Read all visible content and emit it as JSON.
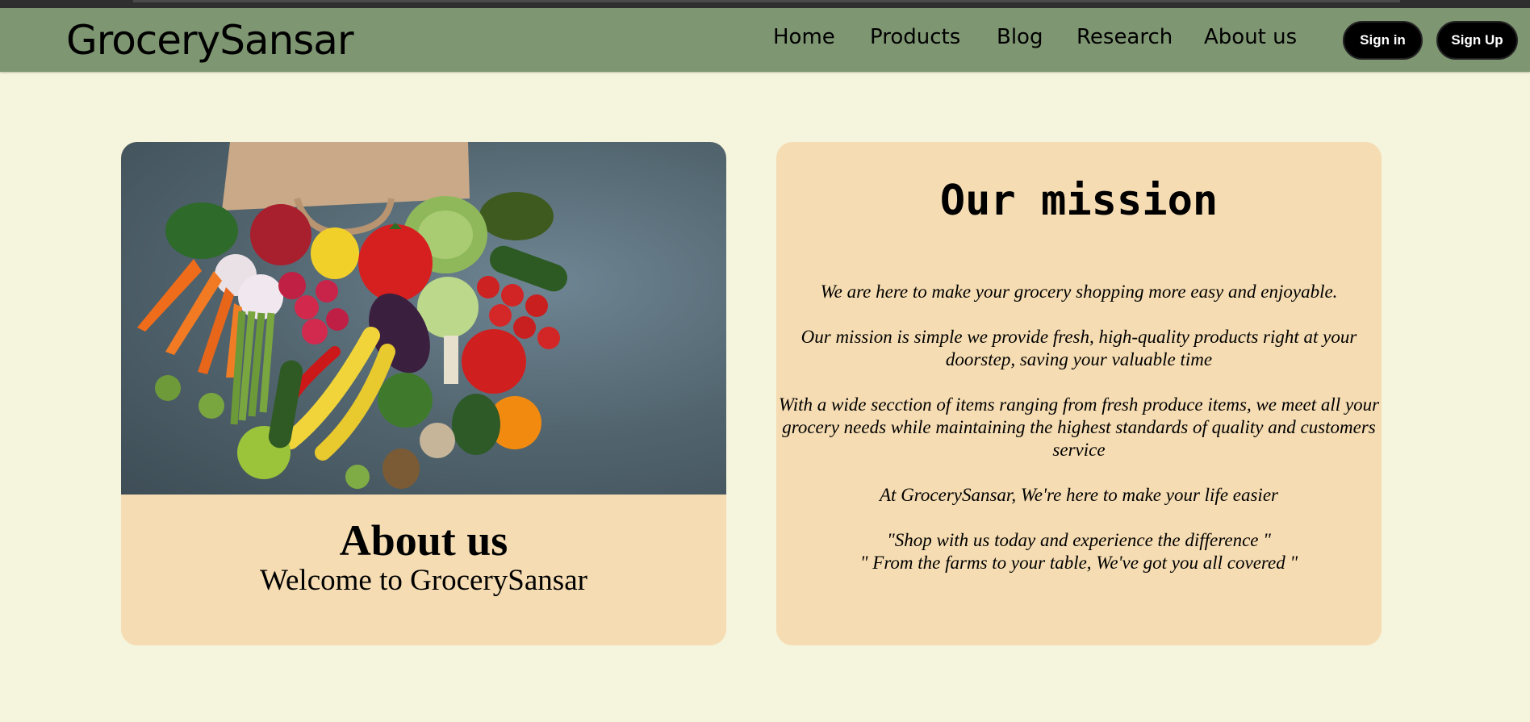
{
  "nav": {
    "brand": "GrocerySansar",
    "links": [
      "Home",
      "Products",
      "Blog",
      "Research",
      "About us"
    ],
    "signin_label": "Sign in",
    "signup_label": "Sign Up"
  },
  "about_card": {
    "title": "About us",
    "subtitle": "Welcome to GrocerySansar",
    "image_icon": "vegetables-photo"
  },
  "mission_card": {
    "title": "Our mission",
    "paragraphs": [
      "We are here to make your grocery shopping more easy and enjoyable.",
      "Our mission is simple we provide fresh, high-quality products right at your doorstep, saving your valuable time",
      "With a wide secction of items ranging from fresh produce items, we meet all your grocery needs while maintaining the highest standards of quality and customers service",
      "At GrocerySansar, We're here to make your life easier"
    ],
    "quote_1": "\"Shop with us today and experience the difference \"",
    "quote_2": "\" From the farms to your table, We've got you all covered \""
  },
  "colors": {
    "page_bg": "#f5f4dc",
    "navbar_bg": "#7f9672",
    "card_bg": "#f5dcb2",
    "button_bg": "#000000"
  }
}
